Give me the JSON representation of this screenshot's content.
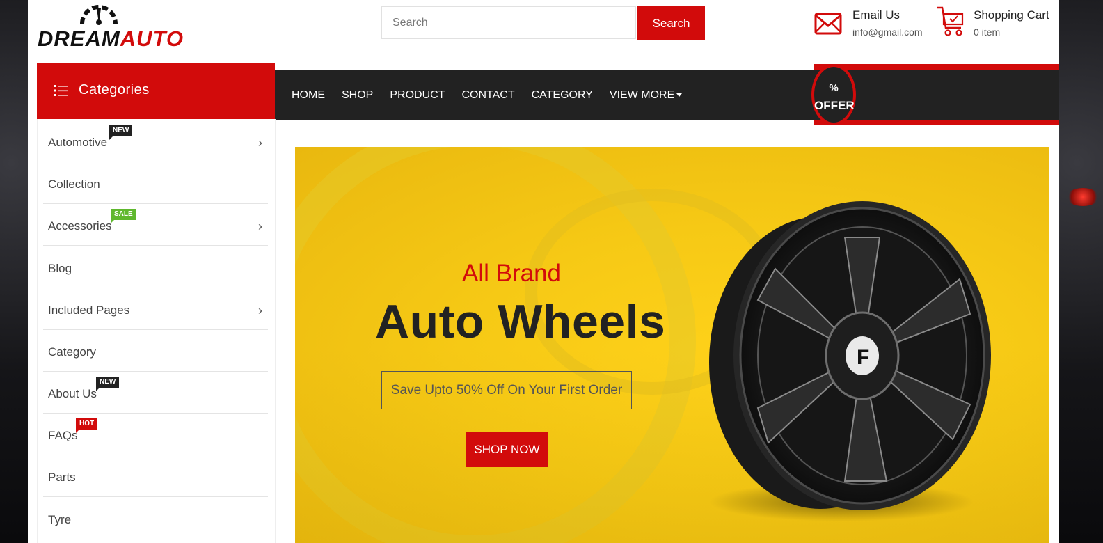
{
  "logo": {
    "part1": "DREAM",
    "part2": "AUTO"
  },
  "search": {
    "placeholder": "Search",
    "button": "Search"
  },
  "header": {
    "email": {
      "title": "Email Us",
      "value": "info@gmail.com",
      "icon": "envelope-icon"
    },
    "cart": {
      "title": "Shopping Cart",
      "value": "0 item",
      "icon": "cart-icon"
    }
  },
  "nav": {
    "items": [
      "HOME",
      "SHOP",
      "PRODUCT",
      "CONTACT",
      "CATEGORY",
      "VIEW MORE"
    ],
    "offer": {
      "symbol": "%",
      "label": "OFFER"
    }
  },
  "sidebar": {
    "title": "Categories",
    "items": [
      {
        "label": "Automotive",
        "badge": "NEW",
        "chevron": true
      },
      {
        "label": "Collection",
        "badge": "",
        "chevron": false
      },
      {
        "label": "Accessories",
        "badge": "SALE",
        "chevron": true
      },
      {
        "label": "Blog",
        "badge": "",
        "chevron": false
      },
      {
        "label": "Included Pages",
        "badge": "",
        "chevron": true
      },
      {
        "label": "Category",
        "badge": "",
        "chevron": false
      },
      {
        "label": "About Us",
        "badge": "NEW",
        "chevron": false
      },
      {
        "label": "FAQs",
        "badge": "HOT",
        "chevron": false
      },
      {
        "label": "Parts",
        "badge": "",
        "chevron": false
      },
      {
        "label": "Tyre",
        "badge": "",
        "chevron": false
      }
    ]
  },
  "hero": {
    "subtitle": "All Brand",
    "title": "Auto Wheels",
    "offer": "Save Upto 50% Off On Your First Order",
    "button": "SHOP NOW"
  },
  "colors": {
    "accent": "#d20b0b",
    "dark": "#222222",
    "banner": "#f6c915",
    "new": "#222222",
    "sale": "#5fb82e",
    "hot": "#d20b0b"
  }
}
